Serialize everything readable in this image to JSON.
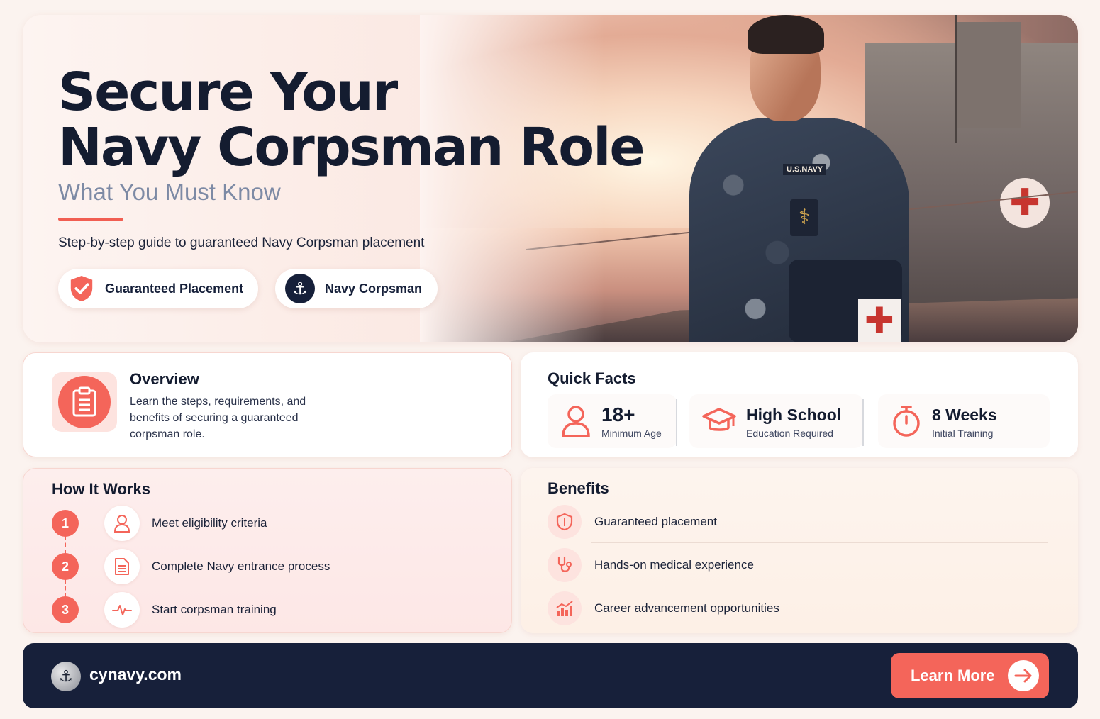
{
  "hero": {
    "title_line1": "Secure Your",
    "title_line2": "Navy Corpsman Role",
    "subtitle": "What You Must Know",
    "description": "Step-by-step guide to guaranteed Navy Corpsman placement",
    "uniform_tag": "U.S.NAVY",
    "badges": [
      {
        "label": "Guaranteed Placement",
        "icon": "shield-check-icon"
      },
      {
        "label": "Navy Corpsman",
        "icon": "anchor-icon"
      }
    ]
  },
  "overview": {
    "title": "Overview",
    "text": "Learn the steps, requirements, and benefits of securing a guaranteed corpsman role.",
    "icon": "clipboard-icon"
  },
  "quick_facts": {
    "title": "Quick Facts",
    "items": [
      {
        "value": "18+",
        "label": "Minimum Age",
        "icon": "person-icon"
      },
      {
        "value": "High School",
        "label": "Education Required",
        "icon": "graduation-cap-icon"
      },
      {
        "value": "8 Weeks",
        "label": "Initial Training",
        "icon": "stopwatch-icon"
      }
    ]
  },
  "how_it_works": {
    "title": "How It Works",
    "steps": [
      {
        "number": "1",
        "label": "Meet eligibility criteria",
        "icon": "person-icon"
      },
      {
        "number": "2",
        "label": "Complete Navy entrance process",
        "icon": "document-icon"
      },
      {
        "number": "3",
        "label": "Start corpsman training",
        "icon": "heartbeat-icon"
      }
    ]
  },
  "benefits": {
    "title": "Benefits",
    "items": [
      {
        "label": "Guaranteed placement",
        "icon": "shield-icon"
      },
      {
        "label": "Hands-on medical experience",
        "icon": "stethoscope-icon"
      },
      {
        "label": "Career advancement opportunities",
        "icon": "growth-chart-icon"
      }
    ]
  },
  "footer": {
    "site": "cynavy.com",
    "cta_label": "Learn More"
  },
  "colors": {
    "accent": "#f4655a",
    "navy": "#17203a",
    "subtitle": "#7d8aa5",
    "background": "#fbf3ef"
  }
}
